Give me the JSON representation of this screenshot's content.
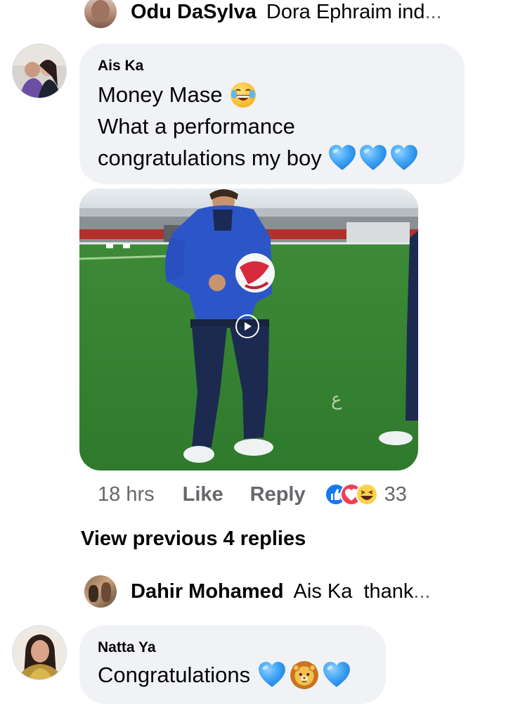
{
  "top_reply": {
    "name": "Odu DaSylva",
    "text": "Dora Ephraim ind",
    "ellipsis": "..."
  },
  "comment": {
    "author": "Ais Ka",
    "lines": [
      "Money Mase",
      "What a performance",
      "congratulations my boy"
    ],
    "emojis": {
      "line1": "joy-emoji",
      "line3": [
        "blue-heart-emoji",
        "blue-heart-emoji",
        "blue-heart-emoji"
      ]
    },
    "video": {
      "play_icon": "play-icon"
    },
    "meta": {
      "time": "18 hrs",
      "like": "Like",
      "reply": "Reply",
      "reaction_count": "33",
      "reactions": [
        "like-reaction",
        "love-reaction",
        "haha-reaction"
      ]
    }
  },
  "view_previous": "View previous 4 replies",
  "reply_preview": {
    "name": "Dahir Mohamed",
    "text": "Ais Ka  thank",
    "ellipsis": "..."
  },
  "reply": {
    "author": "Natta Ya",
    "text": "Congratulations",
    "emojis": [
      "blue-heart-emoji",
      "lion-emoji",
      "blue-heart-emoji"
    ]
  },
  "colors": {
    "bubble": "#f0f2f5",
    "secondary_text": "#65676b",
    "primary_text": "#050505",
    "like_blue": "#1877f2",
    "heart_blue": "#3aa0f5"
  }
}
